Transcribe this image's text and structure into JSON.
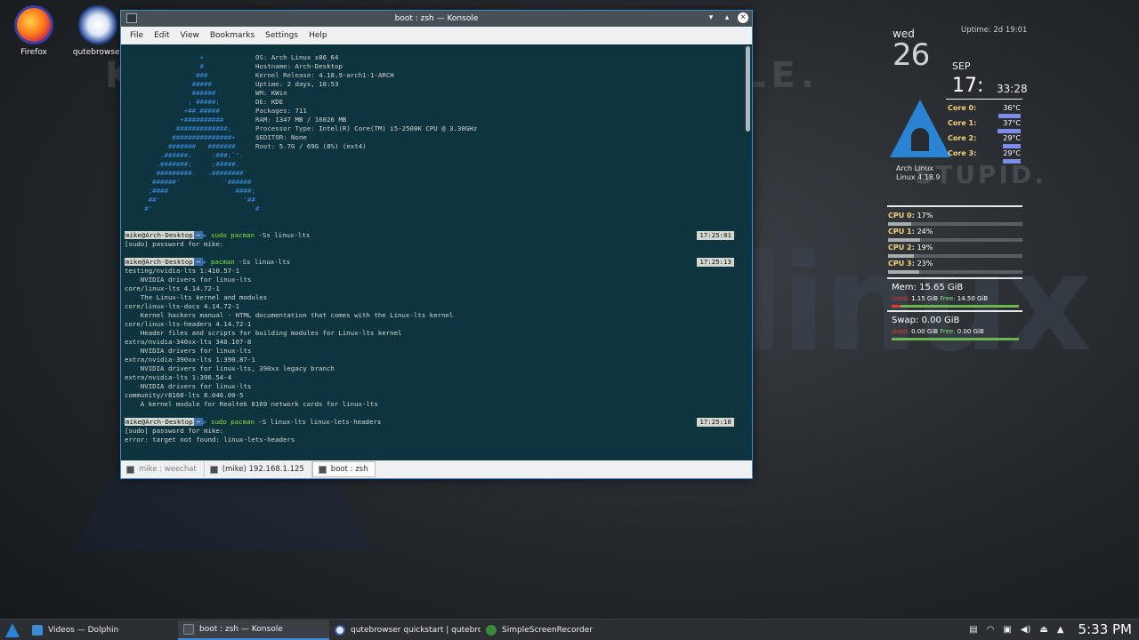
{
  "desktop": {
    "icons": [
      {
        "label": "Firefox"
      },
      {
        "label": "qutebrowser"
      }
    ],
    "wallpaper": {
      "linux": "linux",
      "stupid": "STUPID.",
      "ble": "LE.",
      "k": "K"
    }
  },
  "window": {
    "title": "boot : zsh — Konsole",
    "menu": [
      "File",
      "Edit",
      "View",
      "Bookmarks",
      "Settings",
      "Help"
    ],
    "tabs": [
      {
        "label": "mike : weechat",
        "active": false
      },
      {
        "label": "(mike) 192.168.1.125",
        "active": false
      },
      {
        "label": "boot : zsh",
        "active": true
      }
    ]
  },
  "terminal": {
    "ascii_art": [
      "                   +",
      "                   #",
      "                  ###",
      "                 #####",
      "                 ######",
      "                ; #####;",
      "               +##.#####",
      "              +##########",
      "             #############;",
      "            ###############+",
      "           #######   #######",
      "         .######;     ;###;`\".",
      "        .#######;     ;#####.",
      "        #########.   .########`",
      "       ######'           '######",
      "      ;####                 ####;",
      "      ##'                     '##",
      "     #'                         `#"
    ],
    "info": [
      {
        "label": "OS:",
        "value": "Arch Linux x86_64"
      },
      {
        "label": "Hostname:",
        "value": "Arch-Desktop"
      },
      {
        "label": "Kernel Release:",
        "value": "4.18.9-arch1-1-ARCH"
      },
      {
        "label": "Uptime:",
        "value": "2 days, 18:53"
      },
      {
        "label": "WM:",
        "value": "KWin"
      },
      {
        "label": "DE:",
        "value": "KDE"
      },
      {
        "label": "Packages:",
        "value": "711"
      },
      {
        "label": "RAM:",
        "value": "1347 MB / 16026 MB"
      },
      {
        "label": "Processor Type:",
        "value": "Intel(R) Core(TM) i5-2500K CPU @ 3.30GHz"
      },
      {
        "label": "$EDITOR:",
        "value": "None"
      },
      {
        "label": "Root:",
        "value": "5.7G / 69G (8%) (ext4)"
      }
    ],
    "prompt_user": "mike@Arch-Desktop",
    "prompt_dir": "~",
    "commands": [
      {
        "cmd_prefix": "sudo",
        "cmd_bin": "pacman",
        "cmd_args": "-Ss linux-lts",
        "time": "17:25:01",
        "output": [
          "[sudo] password for mike:"
        ]
      },
      {
        "cmd_prefix": "",
        "cmd_bin": "pacman",
        "cmd_args": "-Ss linux-lts",
        "time": "17:25:13",
        "output": [
          "testing/nvidia-lts 1:410.57-1",
          "    NVIDIA drivers for linux-lts",
          "core/linux-lts 4.14.72-1",
          "    The Linux-lts kernel and modules",
          "core/linux-lts-docs 4.14.72-1",
          "    Kernel hackers manual - HTML documentation that comes with the Linux-lts kernel",
          "core/linux-lts-headers 4.14.72-1",
          "    Header files and scripts for building modules for Linux-lts kernel",
          "extra/nvidia-340xx-lts 340.107-8",
          "    NVIDIA drivers for linux-lts",
          "extra/nvidia-390xx-lts 1:390.87-1",
          "    NVIDIA drivers for linux-lts, 390xx legacy branch",
          "extra/nvidia-lts 1:396.54-4",
          "    NVIDIA drivers for linux-lts",
          "community/r8168-lts 8.046.00-5",
          "    A kernel module for Realtek 8169 network cards for linux-lts"
        ]
      },
      {
        "cmd_prefix": "sudo",
        "cmd_bin": "pacman",
        "cmd_args": "-S linux-lts linux-lets-headers",
        "time": "17:25:18",
        "output": [
          "[sudo] password for mike:",
          "error: target not found: linux-lets-headers"
        ]
      }
    ]
  },
  "conky": {
    "weekday": "wed",
    "day": "26",
    "month": "SEP",
    "time_hm": "17:",
    "time_ms": "33:28",
    "uptime": "Uptime: 2d 19:01",
    "distro": "Arch Linux",
    "kernel": "Linux 4.18.9",
    "cores": [
      {
        "label": "Core 0:",
        "temp": "36°C",
        "level": 0.36
      },
      {
        "label": "Core 1:",
        "temp": "37°C",
        "level": 0.37
      },
      {
        "label": "Core 2:",
        "temp": "29°C",
        "level": 0.29
      },
      {
        "label": "Core 3:",
        "temp": "29°C",
        "level": 0.29
      }
    ],
    "cpus": [
      {
        "label": "CPU 0:",
        "value": "17%",
        "level": 0.17
      },
      {
        "label": "CPU 1:",
        "value": "24%",
        "level": 0.24
      },
      {
        "label": "CPU 2:",
        "value": "19%",
        "level": 0.19
      },
      {
        "label": "CPU 3:",
        "value": "23%",
        "level": 0.23
      }
    ],
    "mem": {
      "title": "Mem:",
      "total": "15.65 GiB",
      "used_label": "Used:",
      "used": "1.15 GiB",
      "free_label": "Free:",
      "free": "14.50 GiB",
      "used_fraction": 0.07
    },
    "swap": {
      "title": "Swap:",
      "total": "0.00 GiB",
      "used_label": "Used:",
      "used": "0.00 GiB",
      "free_label": "Free:",
      "free": "0.00 GiB",
      "used_fraction": 0
    }
  },
  "taskbar": {
    "tasks": [
      {
        "label": "Videos — Dolphin",
        "icon": "dolphin-icon"
      },
      {
        "label": "boot : zsh — Konsole",
        "icon": "konsole-icon"
      },
      {
        "label": "qutebrowser quickstart | qutebro...",
        "icon": "qutebrowser-icon"
      },
      {
        "label": "SimpleScreenRecorder",
        "icon": "recorder-icon"
      }
    ],
    "clock": "5:33 PM",
    "tray_up_arrow": "▲"
  },
  "colors": {
    "accent": "#3d8bd2",
    "terminal_bg": "#0e3440",
    "ascii": "#3b8ee0",
    "command": "#8ae234",
    "conky_label": "#f5d47a"
  }
}
